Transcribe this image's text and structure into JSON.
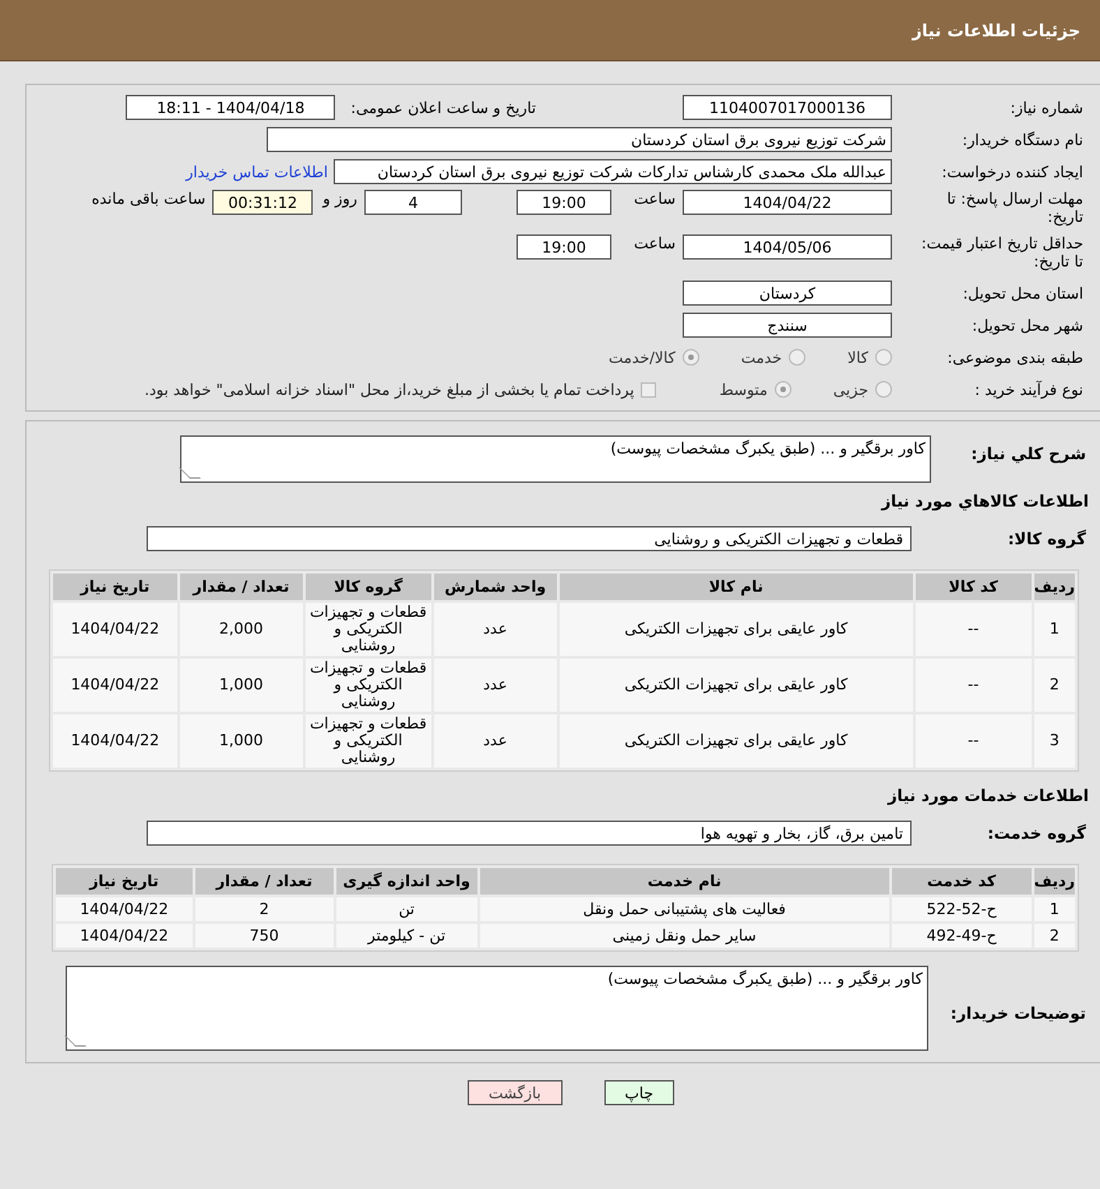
{
  "header": {
    "title": "جزئیات اطلاعات نیاز"
  },
  "details": {
    "need_number": {
      "label": "شماره نیاز:",
      "value": "1104007017000136"
    },
    "announce": {
      "label": "تاریخ و ساعت اعلان عمومی:",
      "value": "1404/04/18 - 18:11"
    },
    "buyer_org": {
      "label": "نام دستگاه خریدار:",
      "value": "شرکت توزیع نیروی برق استان کردستان"
    },
    "requester": {
      "label": "ایجاد کننده درخواست:",
      "value": "عبدالله ملک محمدی کارشناس تدارکات شرکت توزیع نیروی برق استان کردستان",
      "link": "اطلاعات تماس خریدار"
    },
    "reply_deadline": {
      "label": "مهلت ارسال پاسخ: تا تاریخ:",
      "date": "1404/04/22",
      "time_label": "ساعت",
      "time": "19:00",
      "days": "4",
      "days_label": "روز و",
      "remaining": "00:31:12",
      "remaining_label": "ساعت باقی مانده"
    },
    "price_validity": {
      "label": "حداقل تاریخ اعتبار قیمت: تا تاریخ:",
      "date": "1404/05/06",
      "time_label": "ساعت",
      "time": "19:00"
    },
    "province": {
      "label": "استان محل تحویل:",
      "value": "کردستان"
    },
    "city": {
      "label": "شهر محل تحویل:",
      "value": "سنندج"
    },
    "category": {
      "label": "طبقه بندی موضوعی:",
      "options": [
        {
          "label": "کالا",
          "selected": false
        },
        {
          "label": "خدمت",
          "selected": false
        },
        {
          "label": "کالا/خدمت",
          "selected": true
        }
      ]
    },
    "process": {
      "label": "نوع فرآیند خرید :",
      "options": [
        {
          "label": "جزیی",
          "selected": false
        },
        {
          "label": "متوسط",
          "selected": true
        }
      ],
      "payment": {
        "checked": false,
        "text": "پرداخت تمام یا بخشی از مبلغ خرید،از محل \"اسناد خزانه اسلامی\" خواهد بود."
      }
    }
  },
  "description": {
    "label": "شرح کلي نياز:",
    "value": "کاور برقگیر و ... (طبق یکبرگ مشخصات پیوست)"
  },
  "goods": {
    "title": "اطلاعات کالاهاي مورد نياز",
    "group_label": "گروه کالا:",
    "group": "قطعات و تجهیزات الکتریکی و روشنایی",
    "columns": [
      "ردیف",
      "کد کالا",
      "نام کالا",
      "واحد شمارش",
      "گروه کالا",
      "تعداد / مقدار",
      "تاریخ نیاز"
    ],
    "rows": [
      [
        "1",
        "--",
        "کاور عایقی برای تجهیزات الکتریکی",
        "عدد",
        "قطعات و تجهیزات الکتریکی و روشنایی",
        "2,000",
        "1404/04/22"
      ],
      [
        "2",
        "--",
        "کاور عایقی برای تجهیزات الکتریکی",
        "عدد",
        "قطعات و تجهیزات الکتریکی و روشنایی",
        "1,000",
        "1404/04/22"
      ],
      [
        "3",
        "--",
        "کاور عایقی برای تجهیزات الکتریکی",
        "عدد",
        "قطعات و تجهیزات الکتریکی و روشنایی",
        "1,000",
        "1404/04/22"
      ]
    ]
  },
  "services": {
    "title": "اطلاعات خدمات مورد نیاز",
    "group_label": "گروه خدمت:",
    "group": "تامین برق، گاز، بخار و تهویه هوا",
    "columns": [
      "ردیف",
      "کد خدمت",
      "نام خدمت",
      "واحد اندازه گیری",
      "تعداد / مقدار",
      "تاریخ نیاز"
    ],
    "rows": [
      [
        "1",
        "ح-52-522",
        "فعالیت های پشتیبانی حمل ونقل",
        "تن",
        "2",
        "1404/04/22"
      ],
      [
        "2",
        "ح-49-492",
        "سایر حمل ونقل زمینی",
        "تن - کیلومتر",
        "750",
        "1404/04/22"
      ]
    ]
  },
  "buyer_notes": {
    "label": "توضیحات خریدار:",
    "value": "کاور برقگیر و ... (طبق یکبرگ مشخصات پیوست)"
  },
  "buttons": [
    {
      "kind": "print",
      "label": "چاپ"
    },
    {
      "kind": "back",
      "label": "بازگشت"
    }
  ]
}
